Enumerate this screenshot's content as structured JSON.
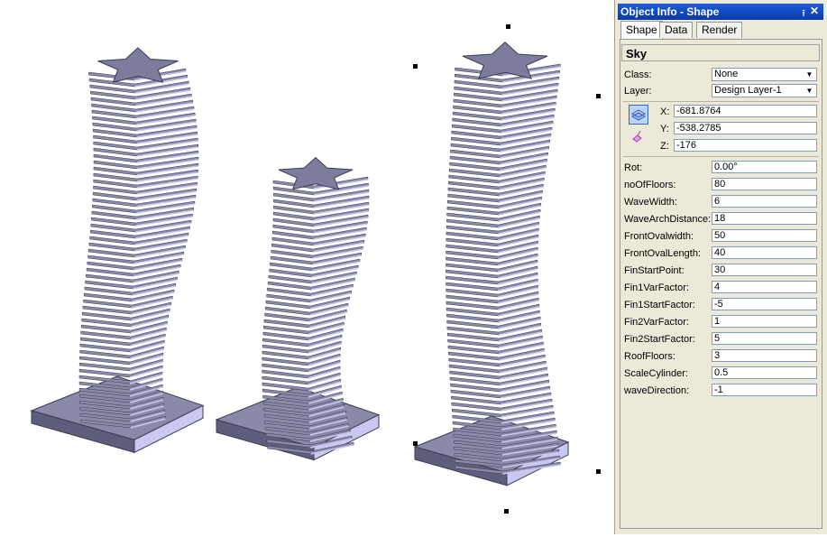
{
  "panel": {
    "title": "Object Info - Shape",
    "pin_icon": "pin-icon",
    "close_icon": "close-icon",
    "tabs": [
      {
        "label": "Shape",
        "active": true
      },
      {
        "label": "Data",
        "active": false
      },
      {
        "label": "Render",
        "active": false
      }
    ],
    "object_name": "Sky",
    "class_label": "Class:",
    "class_value": "None",
    "layer_label": "Layer:",
    "layer_value": "Design Layer-1",
    "x_label": "X:",
    "x_value": "-681.8764",
    "y_label": "Y:",
    "y_value": "-538.2785",
    "z_label": "Z:",
    "z_value": "-176",
    "params": [
      {
        "label": "Rot:",
        "value": "0.00°"
      },
      {
        "label": "noOfFloors:",
        "value": "80"
      },
      {
        "label": "WaveWidth:",
        "value": "6"
      },
      {
        "label": "WaveArchDistance:",
        "value": "18"
      },
      {
        "label": "FrontOvalwidth:",
        "value": "50"
      },
      {
        "label": "FrontOvalLength:",
        "value": "40"
      },
      {
        "label": "FinStartPoint:",
        "value": "30"
      },
      {
        "label": "Fin1VarFactor:",
        "value": "4"
      },
      {
        "label": "Fin1StartFactor:",
        "value": "-5"
      },
      {
        "label": "Fin2VarFactor:",
        "value": "1"
      },
      {
        "label": "Fin2StartFactor:",
        "value": "5"
      },
      {
        "label": "RoofFloors:",
        "value": "3"
      },
      {
        "label": "ScaleCylinder:",
        "value": "0.5"
      },
      {
        "label": "waveDirection:",
        "value": "-1"
      }
    ]
  },
  "viewport": {
    "towers": [
      {
        "name": "tower-left"
      },
      {
        "name": "tower-middle"
      },
      {
        "name": "tower-right"
      }
    ],
    "colors": {
      "face": "#8a8aa8",
      "dark": "#5e5e7c",
      "light": "#c8c8f0",
      "edge": "#3c3c54"
    }
  }
}
